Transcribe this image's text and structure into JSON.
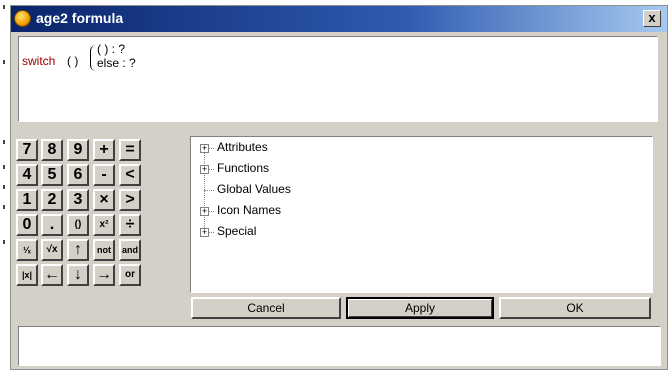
{
  "window": {
    "title": "age2 formula",
    "close_label": "x"
  },
  "formula": {
    "keyword": "switch",
    "args": "( )",
    "case_line": "( ) : ?",
    "else_line": "else : ?"
  },
  "keypad": {
    "rows": [
      [
        "7",
        "8",
        "9",
        "+",
        "="
      ],
      [
        "4",
        "5",
        "6",
        "-",
        "<"
      ],
      [
        "1",
        "2",
        "3",
        "×",
        ">"
      ],
      [
        "0",
        ".",
        "()",
        "x²",
        "÷"
      ],
      [
        "¹⁄ₓ",
        "√x",
        "↑",
        "not",
        "and"
      ],
      [
        "|x|",
        "←",
        "↓",
        "→",
        "or"
      ]
    ]
  },
  "tree": {
    "items": [
      {
        "label": "Attributes",
        "expandable": true
      },
      {
        "label": "Functions",
        "expandable": true
      },
      {
        "label": "Global Values",
        "expandable": false
      },
      {
        "label": "Icon Names",
        "expandable": true
      },
      {
        "label": "Special",
        "expandable": true
      }
    ]
  },
  "buttons": {
    "cancel": "Cancel",
    "apply": "Apply",
    "ok": "OK"
  },
  "colors": {
    "title_start": "#0a246a",
    "title_end": "#a6caf0",
    "keyword": "#a00000",
    "face": "#d4d0c8"
  }
}
